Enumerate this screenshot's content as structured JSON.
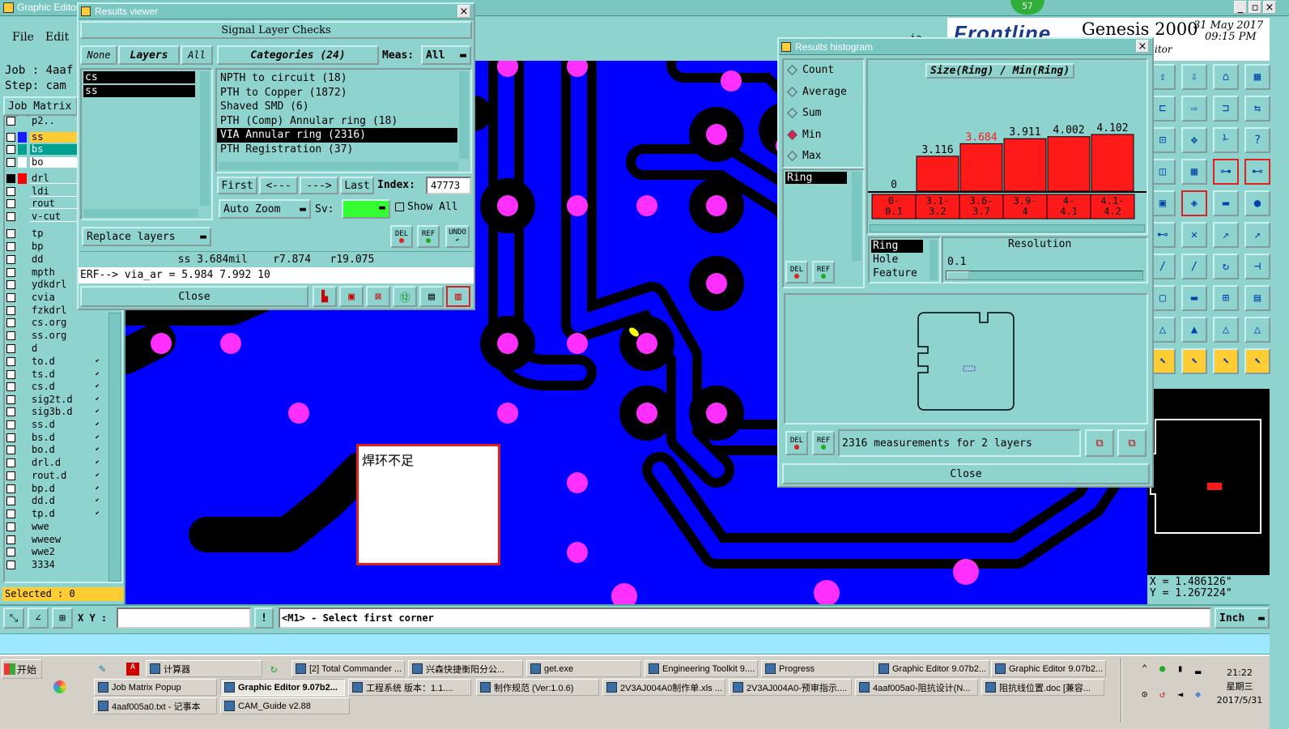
{
  "app": {
    "window_title": "Graphic Editor",
    "menu": [
      "File",
      "Edit"
    ],
    "job_label": "Job : 4aaf",
    "step_label": "Step: cam",
    "job_matrix": "Job Matrix",
    "selected": "Selected : 0",
    "xy_label": "X Y :",
    "prompt": "<M1> - Select first corner",
    "unit": "Inch",
    "coord_x": "X = 1.486126\"",
    "coord_y": "Y = 1.267224\"",
    "notification_badge": "57",
    "brand": "Genesis 2000",
    "brand_logo": "Frontline",
    "brand_sub": "itor",
    "date": "31 May 2017",
    "time": "09:15 PM",
    "partial_label": "ia"
  },
  "layers": [
    {
      "name": "p2..",
      "color": "#8fd3cf"
    },
    {
      "name": "ss",
      "color": "#1a1aff",
      "highlight": "#ffcc33"
    },
    {
      "name": "bs",
      "color": "#00a090",
      "highlight": "#00a090"
    },
    {
      "name": "bo",
      "color": "#ffffff",
      "highlight": "#ffffff"
    },
    {
      "name": "drl",
      "color": "#ff0000"
    },
    {
      "name": "ldi",
      "color": "#8fd3cf"
    },
    {
      "name": "rout",
      "color": "#8fd3cf"
    },
    {
      "name": "v-cut",
      "color": "#8fd3cf"
    },
    {
      "name": "tp",
      "color": "#8fd3cf"
    },
    {
      "name": "bp",
      "color": "#8fd3cf"
    },
    {
      "name": "dd",
      "color": "#8fd3cf"
    },
    {
      "name": "mpth",
      "color": "#8fd3cf"
    },
    {
      "name": "ydkdrl",
      "color": "#8fd3cf"
    },
    {
      "name": "cvia",
      "color": "#8fd3cf"
    },
    {
      "name": "fzkdrl",
      "color": "#8fd3cf"
    },
    {
      "name": "cs.org",
      "color": "#8fd3cf"
    },
    {
      "name": "ss.org",
      "color": "#8fd3cf"
    },
    {
      "name": "d",
      "color": "#8fd3cf"
    },
    {
      "name": "to.d",
      "color": "#8fd3cf"
    },
    {
      "name": "ts.d",
      "color": "#8fd3cf"
    },
    {
      "name": "cs.d",
      "color": "#8fd3cf"
    },
    {
      "name": "sig2t.d",
      "color": "#8fd3cf"
    },
    {
      "name": "sig3b.d",
      "color": "#8fd3cf"
    },
    {
      "name": "ss.d",
      "color": "#8fd3cf"
    },
    {
      "name": "bs.d",
      "color": "#8fd3cf"
    },
    {
      "name": "bo.d",
      "color": "#8fd3cf"
    },
    {
      "name": "drl.d",
      "color": "#8fd3cf"
    },
    {
      "name": "rout.d",
      "color": "#8fd3cf"
    },
    {
      "name": "bp.d",
      "color": "#8fd3cf"
    },
    {
      "name": "dd.d",
      "color": "#8fd3cf"
    },
    {
      "name": "tp.d",
      "color": "#8fd3cf"
    },
    {
      "name": "wwe",
      "color": "#8fd3cf"
    },
    {
      "name": "wweew",
      "color": "#8fd3cf"
    },
    {
      "name": "wwe2",
      "color": "#8fd3cf"
    },
    {
      "name": "3334",
      "color": "#8fd3cf"
    }
  ],
  "results_viewer": {
    "title": "Results viewer",
    "header": "Signal Layer Checks",
    "none": "None",
    "layers": "Layers",
    "all": "All",
    "categories": "Categories (24)",
    "meas_label": "Meas:",
    "meas_value": "All",
    "layer_list": [
      "cs",
      "ss"
    ],
    "category_list": [
      "NPTH to circuit (18)",
      "PTH to Copper (1872)",
      "Shaved SMD (6)",
      "PTH (Comp) Annular ring (18)",
      "VIA Annular ring (2316)",
      "PTH Registration (37)"
    ],
    "selected_category": 4,
    "first": "First",
    "prev": "<---",
    "next": "--->",
    "last": "Last",
    "index_label": "Index:",
    "index_value": "47773",
    "auto_zoom": "Auto Zoom",
    "sv_label": "Sv:",
    "show_all": "Show All",
    "replace_layers": "Replace layers",
    "del": "DEL",
    "ref": "REF",
    "undo": "UNDO",
    "status_line": "ss 3.684mil    r7.874   r19.075",
    "erf_line": "ERF--> via_ar = 5.984 7.992 10",
    "close": "Close"
  },
  "note": {
    "text": "焊环不足"
  },
  "histogram": {
    "title": "Results histogram",
    "options": [
      "Count",
      "Average",
      "Sum",
      "Min",
      "Max"
    ],
    "selected_option": "Min",
    "chart_title": "Size(Ring) / Min(Ring)",
    "type_list": [
      "Ring"
    ],
    "feature_list": [
      "Ring",
      "Hole",
      "Feature"
    ],
    "resolution_label": "Resolution",
    "resolution_value": "0.1",
    "measurements": "2316 measurements for 2 layers",
    "close": "Close",
    "del": "DEL",
    "ref": "REF"
  },
  "chart_data": {
    "type": "bar",
    "title": "Size(Ring) / Min(Ring)",
    "categories": [
      "0-0.1",
      "3.1-3.2",
      "3.6-3.7",
      "3.9-4",
      "4-4.1",
      "4.1-4.2"
    ],
    "category_labels": [
      [
        "0-",
        "0.1"
      ],
      [
        "3.1-",
        "3.2"
      ],
      [
        "3.6-",
        "3.7"
      ],
      [
        "3.9-",
        "4"
      ],
      [
        "4-",
        "4.1"
      ],
      [
        "4.1-",
        "4.2"
      ]
    ],
    "values": [
      0,
      3.116,
      3.684,
      3.911,
      4.002,
      4.102
    ],
    "value_labels": [
      "0",
      "3.116",
      "3.684",
      "3.911",
      "4.002",
      "4.102"
    ],
    "highlight_index": 2,
    "bar_color": "#ff1a1a",
    "highlight_label_color": "#ff1a1a",
    "ylim": [
      0,
      4.102
    ]
  },
  "taskbar": {
    "start": "开始",
    "row1": [
      {
        "label": "计算器"
      },
      {
        "label": "[2] Total Commander ..."
      },
      {
        "label": "兴森快捷衡阳分公..."
      },
      {
        "label": "get.exe"
      },
      {
        "label": "Engineering Toolkit 9...."
      },
      {
        "label": "Progress"
      },
      {
        "label": "Graphic Editor 9.07b2..."
      },
      {
        "label": "Graphic Editor 9.07b2..."
      }
    ],
    "row2": [
      {
        "label": "Job Matrix Popup"
      },
      {
        "label": "Graphic Editor 9.07b2..."
      },
      {
        "label": "工程系统   版本：1.1...."
      },
      {
        "label": "制作规范 (Ver:1.0.6)"
      },
      {
        "label": "2V3AJ004A0制作单.xls ..."
      },
      {
        "label": "2V3AJ004A0-预审指示...."
      },
      {
        "label": "4aaf005a0-阻抗设计(N..."
      },
      {
        "label": "阻抗线位置.doc [兼容..."
      }
    ],
    "row3": [
      {
        "label": "4aaf005a0.txt - 记事本"
      },
      {
        "label": "CAM_Guide v2.88"
      }
    ],
    "clock_time": "21:22",
    "clock_day": "星期三",
    "clock_date": "2017/5/31"
  }
}
